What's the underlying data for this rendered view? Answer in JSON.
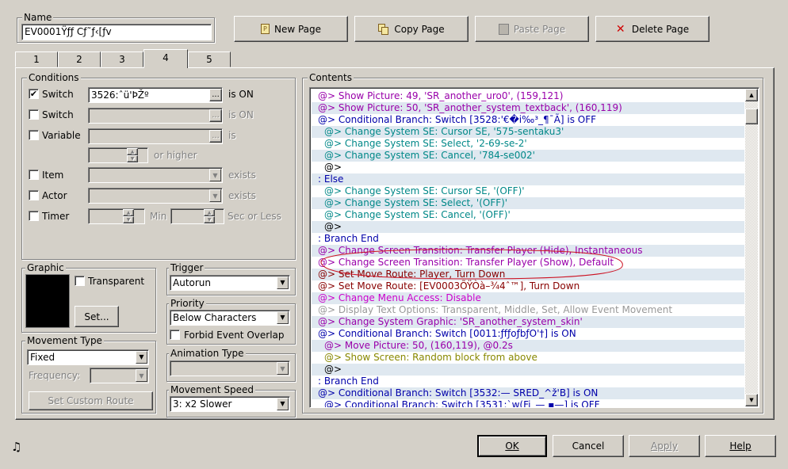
{
  "name_label": "Name",
  "name_value": "EV0001Ÿƒƒ Cƒ˜ƒ‹[ƒv",
  "toolbar": {
    "new_page": "New Page",
    "copy_page": "Copy Page",
    "paste_page": "Paste Page",
    "delete_page": "Delete Page"
  },
  "tabs": [
    "1",
    "2",
    "3",
    "4",
    "5"
  ],
  "active_tab": "4",
  "conditions": {
    "title": "Conditions",
    "switch1_label": "Switch",
    "switch1_value": "3526:ˆü'ÞŽº",
    "switch1_suffix": "is ON",
    "switch2_label": "Switch",
    "switch2_suffix": "is ON",
    "variable_label": "Variable",
    "variable_suffix": "is",
    "or_higher": "or higher",
    "item_label": "Item",
    "item_suffix": "exists",
    "actor_label": "Actor",
    "actor_suffix": "exists",
    "timer_label": "Timer",
    "timer_min": "Min",
    "timer_sec": "Sec or Less",
    "ellipsis": "..."
  },
  "graphic": {
    "title": "Graphic",
    "transparent_label": "Transparent",
    "set_button": "Set..."
  },
  "trigger": {
    "title": "Trigger",
    "value": "Autorun"
  },
  "priority": {
    "title": "Priority",
    "value": "Below Characters",
    "forbid_label": "Forbid Event Overlap"
  },
  "movement_type": {
    "title": "Movement Type",
    "value": "Fixed",
    "frequency_label": "Frequency:",
    "custom_route": "Set Custom Route"
  },
  "animation_type": {
    "title": "Animation Type"
  },
  "movement_speed": {
    "title": "Movement Speed",
    "value": "3: x2 Slower"
  },
  "contents": {
    "title": "Contents",
    "lines": [
      {
        "text": "@> Show Picture: 49, 'SR_another_uro0', (159,121)",
        "indent": 0,
        "color": "#9900aa"
      },
      {
        "text": "@> Show Picture: 50, 'SR_another_system_textback', (160,119)",
        "indent": 0,
        "color": "#9900aa"
      },
      {
        "text": "@> Conditional Branch: Switch [3528:'€�i‰³_¶¯Ã] is OFF",
        "indent": 0,
        "color": "#0000aa"
      },
      {
        "text": "@> Change System SE: Cursor SE, '575-sentaku3'",
        "indent": 1,
        "color": "#008888"
      },
      {
        "text": "@> Change System SE: Select, '2-69-se-2'",
        "indent": 1,
        "color": "#008888"
      },
      {
        "text": "@> Change System SE: Cancel, '784-se002'",
        "indent": 1,
        "color": "#008888"
      },
      {
        "text": "@>",
        "indent": 1,
        "color": "#000000"
      },
      {
        "text": ": Else",
        "indent": 0,
        "color": "#0000aa"
      },
      {
        "text": "@> Change System SE: Cursor SE, '(OFF)'",
        "indent": 1,
        "color": "#008888"
      },
      {
        "text": "@> Change System SE: Select, '(OFF)'",
        "indent": 1,
        "color": "#008888"
      },
      {
        "text": "@> Change System SE: Cancel, '(OFF)'",
        "indent": 1,
        "color": "#008888"
      },
      {
        "text": "@>",
        "indent": 1,
        "color": "#000000"
      },
      {
        "text": ": Branch End",
        "indent": 0,
        "color": "#0000aa"
      },
      {
        "text": "@> Change Screen Transition: Transfer Player (Hide), Instantaneous",
        "indent": 0,
        "color": "#9900aa"
      },
      {
        "text": "@> Change Screen Transition: Transfer Player (Show), Default",
        "indent": 0,
        "color": "#9900aa"
      },
      {
        "text": "@> Set Move Route: Player, Turn Down",
        "indent": 0,
        "color": "#880000"
      },
      {
        "text": "@> Set Move Route: [EV0003ÕŸÒà–¾4ˆ™], Turn Down",
        "indent": 0,
        "color": "#880000"
      },
      {
        "text": "@> Change Menu Access: Disable",
        "indent": 0,
        "color": "#cc00cc"
      },
      {
        "text": "@> Display Text Options: Transparent, Middle, Set, Allow Event Movement",
        "indent": 0,
        "color": "#999999"
      },
      {
        "text": "@> Change System Graphic: 'SR_another_system_skin'",
        "indent": 0,
        "color": "#9900aa"
      },
      {
        "text": "@> Conditional Branch: Switch [0011:ƒfƒoƒbƒO'†] is ON",
        "indent": 0,
        "color": "#0000aa"
      },
      {
        "text": "@> Move Picture: 50, (160,119), @0.2s",
        "indent": 1,
        "color": "#9900aa"
      },
      {
        "text": "@> Show Screen: Random block from above",
        "indent": 1,
        "color": "#888800"
      },
      {
        "text": "@>",
        "indent": 1,
        "color": "#000000"
      },
      {
        "text": ": Branch End",
        "indent": 0,
        "color": "#0000aa"
      },
      {
        "text": "@> Conditional Branch: Switch [3532:— SRED_^ž'B] is ON",
        "indent": 0,
        "color": "#0000aa"
      },
      {
        "text": "@> Conditional Branch: Switch [3531:`w(Fi_— ▪—] is OFF",
        "indent": 1,
        "color": "#0000aa"
      }
    ]
  },
  "bottom": {
    "ok": "OK",
    "cancel": "Cancel",
    "apply": "Apply",
    "help": "Help"
  },
  "music_icon": "music-note-icon"
}
